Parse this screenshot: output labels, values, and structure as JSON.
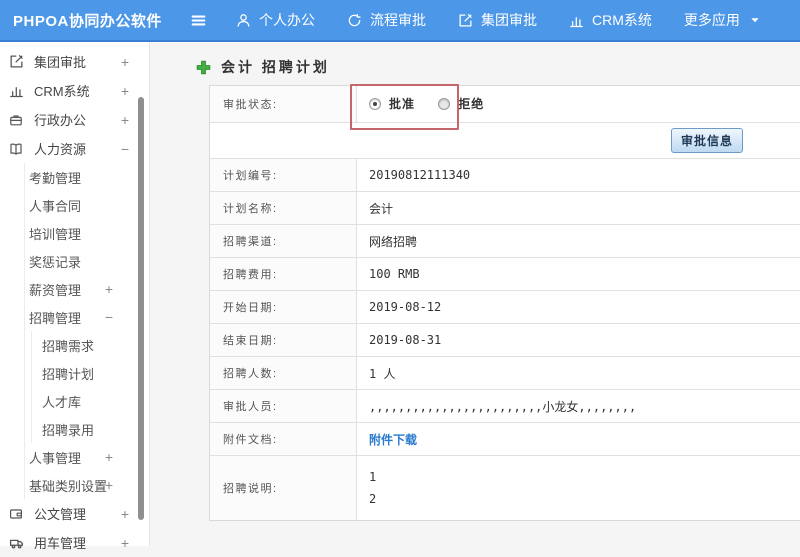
{
  "navbar": {
    "brand": "PHPOA协同办公软件",
    "items": [
      {
        "name": "personal-office",
        "label": "个人办公",
        "icon": "person-icon"
      },
      {
        "name": "flow-approval",
        "label": "流程审批",
        "icon": "flow-icon"
      },
      {
        "name": "group-approval",
        "label": "集团审批",
        "icon": "edit-icon"
      },
      {
        "name": "crm-system",
        "label": "CRM系统",
        "icon": "chart-icon"
      },
      {
        "name": "more-apps",
        "label": "更多应用",
        "icon": "",
        "caret": true
      }
    ]
  },
  "sidebar": {
    "items": [
      {
        "name": "group-approval",
        "label": "集团审批",
        "icon": "edit-icon",
        "expand": "+"
      },
      {
        "name": "crm-system",
        "label": "CRM系统",
        "icon": "chart-icon",
        "expand": "+"
      },
      {
        "name": "admin-office",
        "label": "行政办公",
        "icon": "briefcase-icon",
        "expand": "+"
      },
      {
        "name": "human-resources",
        "label": "人力资源",
        "icon": "book-icon",
        "expand": "−",
        "children": [
          {
            "name": "attendance-mgmt",
            "label": "考勤管理"
          },
          {
            "name": "hr-contract",
            "label": "人事合同"
          },
          {
            "name": "training-mgmt",
            "label": "培训管理"
          },
          {
            "name": "reward-punish-records",
            "label": "奖惩记录"
          },
          {
            "name": "salary-mgmt",
            "label": "薪资管理",
            "expand": "+"
          },
          {
            "name": "recruit-mgmt",
            "label": "招聘管理",
            "expand": "−",
            "children": [
              {
                "name": "recruit-need",
                "label": "招聘需求"
              },
              {
                "name": "recruit-plan",
                "label": "招聘计划"
              },
              {
                "name": "talent-pool",
                "label": "人才库"
              },
              {
                "name": "recruit-hire",
                "label": "招聘录用"
              }
            ]
          },
          {
            "name": "personnel-mgmt",
            "label": "人事管理",
            "expand": "+"
          },
          {
            "name": "base-category-settings",
            "label": "基础类别设置",
            "expand": "+"
          }
        ]
      },
      {
        "name": "document-mgmt",
        "label": "公文管理",
        "icon": "doc-icon",
        "expand": "+"
      },
      {
        "name": "vehicle-mgmt",
        "label": "用车管理",
        "icon": "car-icon",
        "expand": "+"
      }
    ]
  },
  "main": {
    "title": "会计 招聘计划",
    "title_icon": "add-icon",
    "approval": {
      "label": "审批状态:",
      "options": [
        {
          "label": "批准",
          "checked": true
        },
        {
          "label": "拒绝",
          "checked": false
        }
      ]
    },
    "button_label": "审批信息",
    "rows": [
      {
        "label": "计划编号:",
        "value": "20190812111340"
      },
      {
        "label": "计划名称:",
        "value": "会计"
      },
      {
        "label": "招聘渠道:",
        "value": "网络招聘"
      },
      {
        "label": "招聘费用:",
        "value": "100 RMB"
      },
      {
        "label": "开始日期:",
        "value": "2019-08-12"
      },
      {
        "label": "结束日期:",
        "value": "2019-08-31"
      },
      {
        "label": "招聘人数:",
        "value": "1 人"
      },
      {
        "label": "审批人员:",
        "value": ",,,,,,,,,,,,,,,,,,,,,,,,小龙女,,,,,,,,"
      },
      {
        "label": "附件文档:",
        "value": "附件下载",
        "link": true
      },
      {
        "label": "招聘说明:",
        "lines": [
          "1",
          "2"
        ]
      }
    ]
  },
  "colors": {
    "navbar_blue": "#4d97e8",
    "navbar_border": "#3a80d2",
    "link_blue": "#2a7bd0",
    "highlight_red": "#c4666b",
    "button_border": "#6d9bc8",
    "plus_green": "#45b045"
  }
}
